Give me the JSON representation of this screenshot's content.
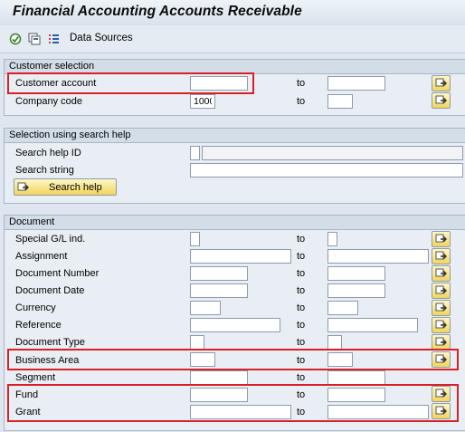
{
  "app": {
    "title": "Financial Accounting Accounts Receivable"
  },
  "toolbar": {
    "data_sources_label": "Data Sources"
  },
  "to_label": "to",
  "customer_selection": {
    "title": "Customer selection",
    "customer_account": {
      "label": "Customer account",
      "from": "",
      "to": ""
    },
    "company_code": {
      "label": "Company code",
      "from": "1000",
      "to": ""
    }
  },
  "search_help": {
    "title": "Selection using search help",
    "search_help_id": {
      "label": "Search help ID",
      "value": ""
    },
    "search_string": {
      "label": "Search string",
      "value": ""
    },
    "button_label": "Search help"
  },
  "document": {
    "title": "Document",
    "special_gl": {
      "label": "Special G/L ind.",
      "from": "",
      "to": ""
    },
    "assignment": {
      "label": "Assignment",
      "from": "",
      "to": ""
    },
    "document_number": {
      "label": "Document Number",
      "from": "",
      "to": ""
    },
    "document_date": {
      "label": "Document Date",
      "from": "",
      "to": ""
    },
    "currency": {
      "label": "Currency",
      "from": "",
      "to": ""
    },
    "reference": {
      "label": "Reference",
      "from": "",
      "to": ""
    },
    "document_type": {
      "label": "Document Type",
      "from": "",
      "to": ""
    },
    "business_area": {
      "label": "Business Area",
      "from": "",
      "to": ""
    },
    "segment": {
      "label": "Segment",
      "from": "",
      "to": ""
    },
    "fund": {
      "label": "Fund",
      "from": "",
      "to": ""
    },
    "grant": {
      "label": "Grant",
      "from": "",
      "to": ""
    }
  },
  "colors": {
    "highlight": "#d92027",
    "button": "#f1d55a",
    "background": "#dfe6ef"
  }
}
